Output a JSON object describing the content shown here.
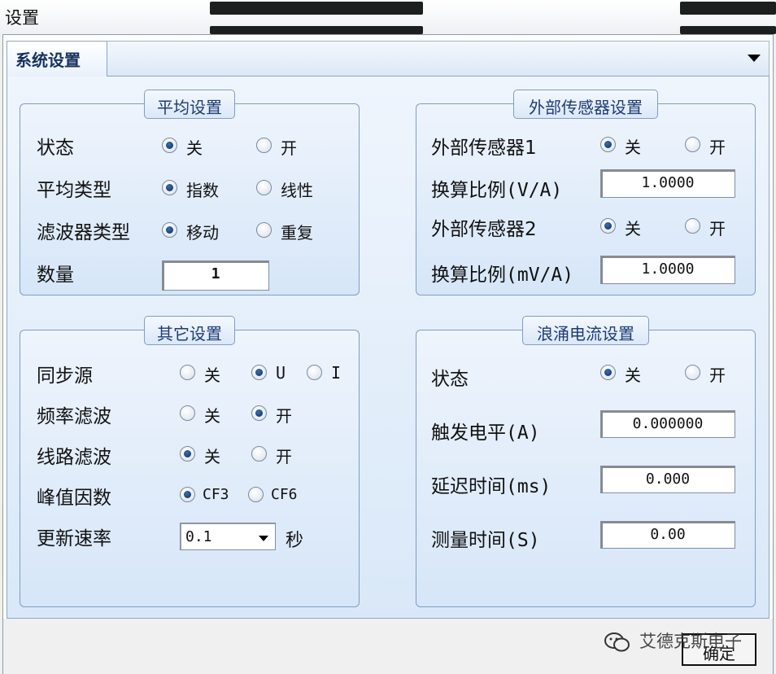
{
  "window": {
    "title": "设置"
  },
  "tabs": [
    {
      "label": "系统设置",
      "active": true
    }
  ],
  "average": {
    "title": "平均设置",
    "state": {
      "label": "状态",
      "options": [
        "关",
        "开"
      ],
      "selected": 0
    },
    "avg_type": {
      "label": "平均类型",
      "options": [
        "指数",
        "线性"
      ],
      "selected": 0
    },
    "filter_type": {
      "label": "滤波器类型",
      "options": [
        "移动",
        "重复"
      ],
      "selected": 0
    },
    "count": {
      "label": "数量",
      "value": "1"
    }
  },
  "external": {
    "title": "外部传感器设置",
    "sensor1": {
      "label": "外部传感器1",
      "options": [
        "关",
        "开"
      ],
      "selected": 0
    },
    "ratio1": {
      "label": "换算比例(V/A)",
      "value": "1.0000"
    },
    "sensor2": {
      "label": "外部传感器2",
      "options": [
        "关",
        "开"
      ],
      "selected": 0
    },
    "ratio2": {
      "label": "换算比例(mV/A)",
      "value": "1.0000"
    }
  },
  "other": {
    "title": "其它设置",
    "sync": {
      "label": "同步源",
      "options": [
        "关",
        "U",
        "I"
      ],
      "selected": 1
    },
    "freq_filter": {
      "label": "频率滤波",
      "options": [
        "关",
        "开"
      ],
      "selected": 1
    },
    "line_filter": {
      "label": "线路滤波",
      "options": [
        "关",
        "开"
      ],
      "selected": 0
    },
    "crest": {
      "label": "峰值因数",
      "options": [
        "CF3",
        "CF6"
      ],
      "selected": 0
    },
    "update_rate": {
      "label": "更新速率",
      "value": "0.1",
      "unit": "秒"
    }
  },
  "inrush": {
    "title": "浪涌电流设置",
    "state": {
      "label": "状态",
      "options": [
        "关",
        "开"
      ],
      "selected": 0
    },
    "trigger": {
      "label": "触发电平(A)",
      "value": "0.000000"
    },
    "delay": {
      "label": "延迟时间(ms)",
      "value": "0.000"
    },
    "measure": {
      "label": "测量时间(S)",
      "value": "0.00"
    }
  },
  "footer": {
    "ok_label": "确定"
  },
  "watermark": {
    "text": "艾德克斯电子"
  },
  "colors": {
    "accent": "#0b2c5c",
    "panel": "#d9e8f8",
    "border": "#7f9dc4"
  }
}
